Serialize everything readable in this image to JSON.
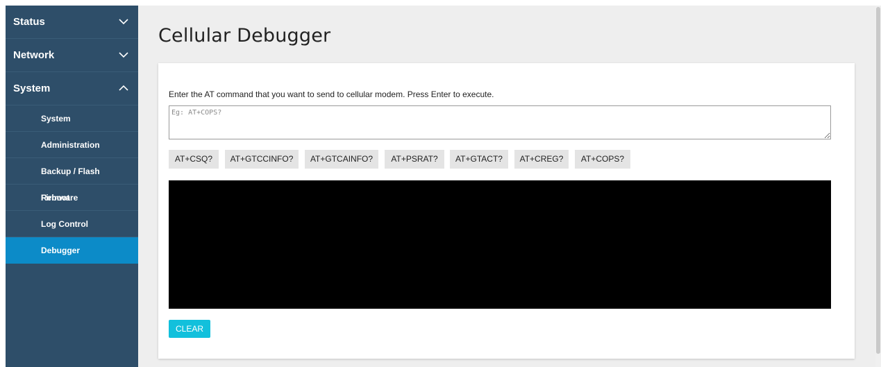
{
  "sidebar": {
    "sections": [
      {
        "label": "Status",
        "chevron": "chevron-down-icon"
      },
      {
        "label": "Network",
        "chevron": "chevron-down-icon"
      },
      {
        "label": "System",
        "chevron": "chevron-up-icon"
      }
    ],
    "items": [
      {
        "label": "System"
      },
      {
        "label": "Administration"
      },
      {
        "label": "Backup / Flash Firmware"
      },
      {
        "label": "Reboot"
      },
      {
        "label": "Log Control"
      },
      {
        "label": "Debugger",
        "active": true
      }
    ]
  },
  "main": {
    "title": "Cellular Debugger",
    "instructions": "Enter the AT command that you want to send to cellular modem. Press Enter to execute.",
    "input": {
      "value": "",
      "placeholder": "Eg: AT+COPS?"
    },
    "quick_commands": [
      "AT+CSQ?",
      "AT+GTCCINFO?",
      "AT+GTCAINFO?",
      "AT+PSRAT?",
      "AT+GTACT?",
      "AT+CREG?",
      "AT+COPS?"
    ],
    "output": "",
    "clear_label": "CLEAR"
  },
  "colors": {
    "sidebar_bg": "#2e4e69",
    "sidebar_active": "#0c8bc8",
    "accent_button": "#12c0dc",
    "terminal_bg": "#000000"
  }
}
